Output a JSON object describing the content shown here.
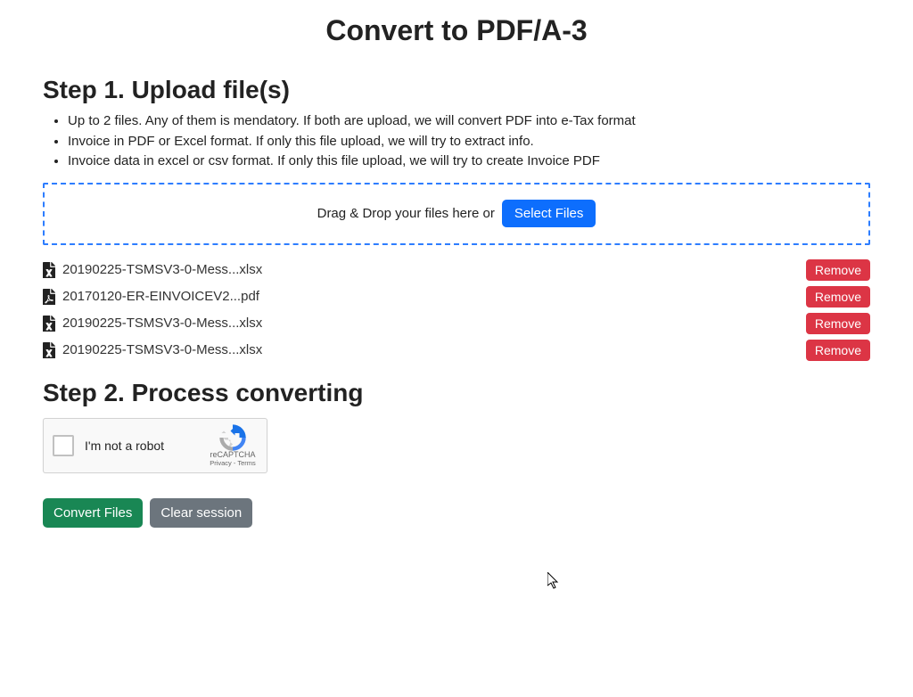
{
  "page_title": "Convert to PDF/A-3",
  "step1": {
    "heading": "Step 1. Upload file(s)",
    "instructions": [
      "Up to 2 files. Any of them is mendatory. If both are upload, we will convert PDF into e-Tax format",
      "Invoice in PDF or Excel format. If only this file upload, we will try to extract info.",
      "Invoice data in excel or csv format. If only this file upload, we will try to create Invoice PDF"
    ],
    "dropzone_text": "Drag & Drop your files here or",
    "select_button": "Select Files"
  },
  "files": [
    {
      "name": "20190225-TSMSV3-0-Mess...xlsx",
      "type": "excel",
      "remove": "Remove"
    },
    {
      "name": "20170120-ER-EINVOICEV2...pdf",
      "type": "pdf",
      "remove": "Remove"
    },
    {
      "name": "20190225-TSMSV3-0-Mess...xlsx",
      "type": "excel",
      "remove": "Remove"
    },
    {
      "name": "20190225-TSMSV3-0-Mess...xlsx",
      "type": "excel",
      "remove": "Remove"
    }
  ],
  "step2": {
    "heading": "Step 2. Process converting",
    "recaptcha_label": "I'm not a robot",
    "recaptcha_brand": "reCAPTCHA",
    "recaptcha_links": "Privacy - Terms",
    "convert_button": "Convert Files",
    "clear_button": "Clear session"
  }
}
